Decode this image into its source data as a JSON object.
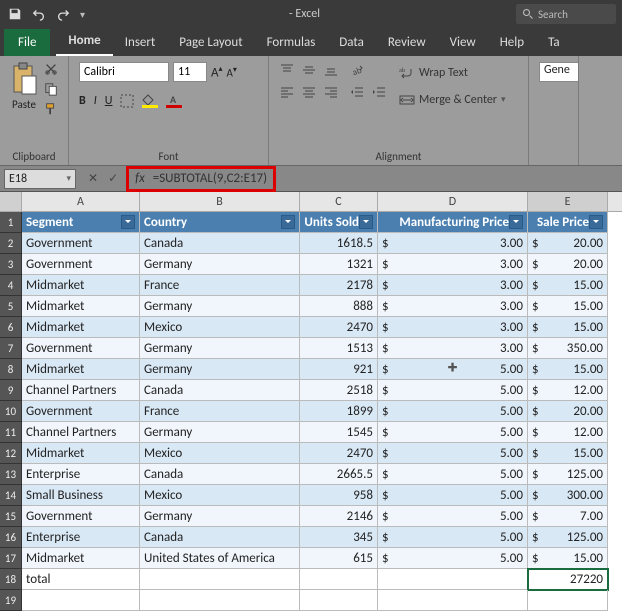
{
  "title": "- Excel",
  "search_placeholder": "Search",
  "tabs": [
    "File",
    "Home",
    "Insert",
    "Page Layout",
    "Formulas",
    "Data",
    "Review",
    "View",
    "Help",
    "Ta"
  ],
  "active_tab": "Home",
  "ribbon": {
    "clipboard": {
      "label": "Clipboard",
      "paste": "Paste"
    },
    "font": {
      "label": "Font",
      "name": "Calibri",
      "size": "11"
    },
    "alignment": {
      "label": "Alignment",
      "wrap": "Wrap Text",
      "merge": "Merge & Center"
    },
    "number": {
      "label": "",
      "general": "Gene"
    }
  },
  "namebox": "E18",
  "formula": "=SUBTOTAL(9,C2:E17)",
  "columns": [
    "A",
    "B",
    "C",
    "D",
    "E"
  ],
  "headers": [
    "Segment",
    "Country",
    "Units Sold",
    "Manufacturing Price",
    "Sale Price"
  ],
  "rows": [
    {
      "seg": "Government",
      "cty": "Canada",
      "units": "1618.5",
      "mp": "3.00",
      "sp": "20.00"
    },
    {
      "seg": "Government",
      "cty": "Germany",
      "units": "1321",
      "mp": "3.00",
      "sp": "20.00"
    },
    {
      "seg": "Midmarket",
      "cty": "France",
      "units": "2178",
      "mp": "3.00",
      "sp": "15.00"
    },
    {
      "seg": "Midmarket",
      "cty": "Germany",
      "units": "888",
      "mp": "3.00",
      "sp": "15.00"
    },
    {
      "seg": "Midmarket",
      "cty": "Mexico",
      "units": "2470",
      "mp": "3.00",
      "sp": "15.00"
    },
    {
      "seg": "Government",
      "cty": "Germany",
      "units": "1513",
      "mp": "3.00",
      "sp": "350.00"
    },
    {
      "seg": "Midmarket",
      "cty": "Germany",
      "units": "921",
      "mp": "5.00",
      "sp": "15.00"
    },
    {
      "seg": "Channel Partners",
      "cty": "Canada",
      "units": "2518",
      "mp": "5.00",
      "sp": "12.00"
    },
    {
      "seg": "Government",
      "cty": "France",
      "units": "1899",
      "mp": "5.00",
      "sp": "20.00"
    },
    {
      "seg": "Channel Partners",
      "cty": "Germany",
      "units": "1545",
      "mp": "5.00",
      "sp": "12.00"
    },
    {
      "seg": "Midmarket",
      "cty": "Mexico",
      "units": "2470",
      "mp": "5.00",
      "sp": "15.00"
    },
    {
      "seg": "Enterprise",
      "cty": "Canada",
      "units": "2665.5",
      "mp": "5.00",
      "sp": "125.00"
    },
    {
      "seg": "Small Business",
      "cty": "Mexico",
      "units": "958",
      "mp": "5.00",
      "sp": "300.00"
    },
    {
      "seg": "Government",
      "cty": "Germany",
      "units": "2146",
      "mp": "5.00",
      "sp": "7.00"
    },
    {
      "seg": "Enterprise",
      "cty": "Canada",
      "units": "345",
      "mp": "5.00",
      "sp": "125.00"
    },
    {
      "seg": "Midmarket",
      "cty": "United States of America",
      "units": "615",
      "mp": "5.00",
      "sp": "15.00"
    }
  ],
  "total_label": "total",
  "total_value": "27220"
}
